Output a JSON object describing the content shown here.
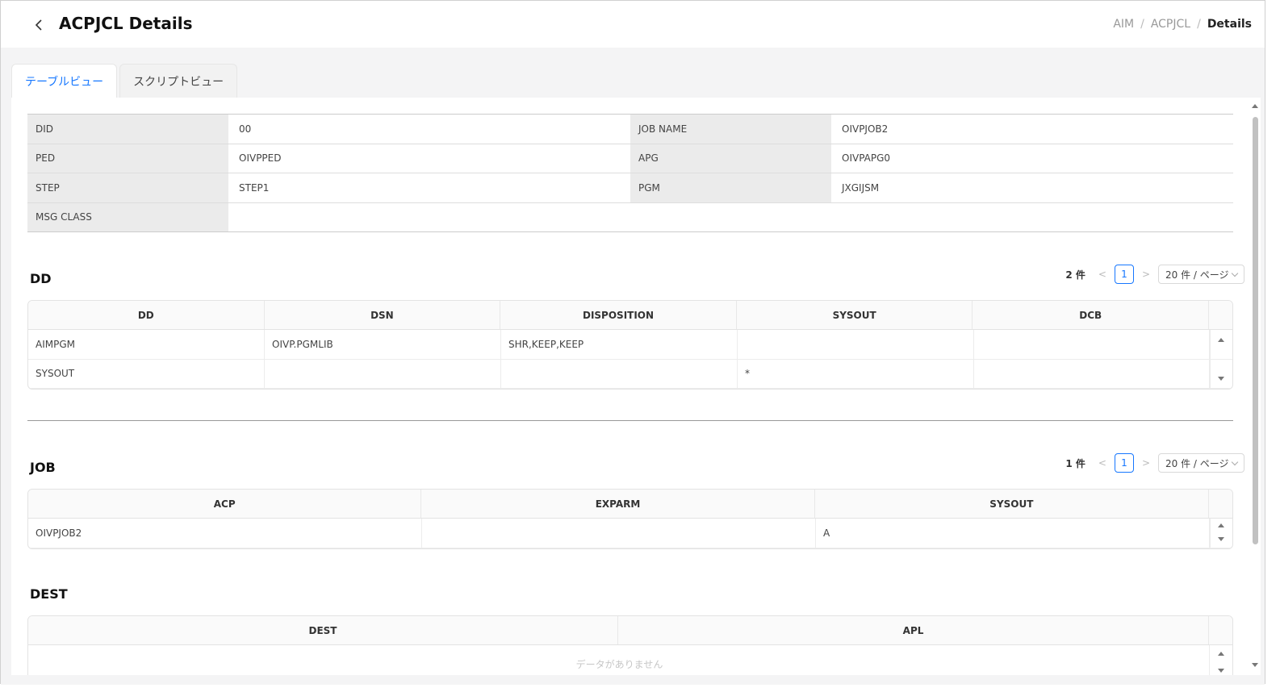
{
  "header": {
    "title": "ACPJCL Details",
    "breadcrumb": [
      "AIM",
      "ACPJCL",
      "Details"
    ],
    "breadcrumb_sep": "/"
  },
  "tabs": [
    {
      "label": "テーブルビュー",
      "active": true
    },
    {
      "label": "スクリプトビュー",
      "active": false
    }
  ],
  "info": {
    "did_label": "DID",
    "did_value": "00",
    "jobname_label": "JOB NAME",
    "jobname_value": "OIVPJOB2",
    "ped_label": "PED",
    "ped_value": "OIVPPED",
    "apg_label": "APG",
    "apg_value": "OIVPAPG0",
    "step_label": "STEP",
    "step_value": "STEP1",
    "pgm_label": "PGM",
    "pgm_value": "JXGIJSM",
    "msgclass_label": "MSG CLASS",
    "msgclass_value": ""
  },
  "dd": {
    "title": "DD",
    "count": "2 件",
    "page": "1",
    "page_size": "20 件 / ページ",
    "prev": "<",
    "next": ">",
    "columns": [
      "DD",
      "DSN",
      "DISPOSITION",
      "SYSOUT",
      "DCB"
    ],
    "rows": [
      [
        "AIMPGM",
        "OIVP.PGMLIB",
        "SHR,KEEP,KEEP",
        "",
        ""
      ],
      [
        "SYSOUT",
        "",
        "",
        "*",
        ""
      ]
    ]
  },
  "job": {
    "title": "JOB",
    "count": "1 件",
    "page": "1",
    "page_size": "20 件 / ページ",
    "prev": "<",
    "next": ">",
    "columns": [
      "ACP",
      "EXPARM",
      "SYSOUT"
    ],
    "rows": [
      [
        "OIVPJOB2",
        "",
        "A"
      ]
    ]
  },
  "dest": {
    "title": "DEST",
    "columns": [
      "DEST",
      "APL"
    ],
    "empty_text": "データがありません"
  }
}
